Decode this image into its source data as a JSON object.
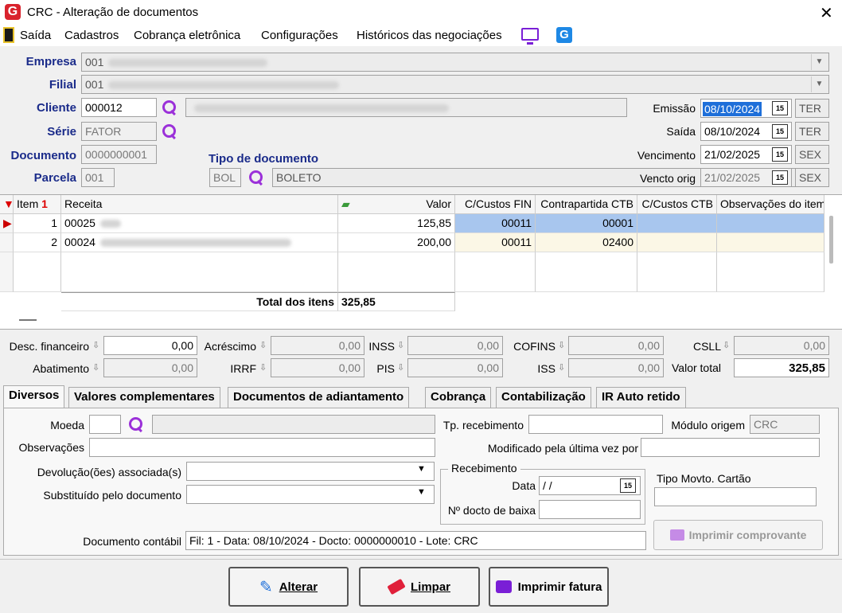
{
  "window": {
    "title": "CRC - Alteração de documentos",
    "logo": "G",
    "close": "✕"
  },
  "menu": [
    "Saída",
    "Cadastros",
    "Cobrança eletrônica",
    "Configurações",
    "Históricos das negociações"
  ],
  "header": {
    "empresa_label": "Empresa",
    "empresa_code": "001",
    "filial_label": "Filial",
    "filial_code": "001",
    "cliente_label": "Cliente",
    "cliente_value": "000012",
    "serie_label": "Série",
    "serie_value": "FATOR",
    "documento_label": "Documento",
    "documento_value": "0000000001",
    "parcela_label": "Parcela",
    "parcela_value": "001",
    "tipo_doc_label": "Tipo de documento",
    "tipo_doc_code": "BOL",
    "tipo_doc_name": "BOLETO",
    "emissao_label": "Emissão",
    "emissao_date": "08/10/2024",
    "emissao_day": "TER",
    "saida_label": "Saída",
    "saida_date": "08/10/2024",
    "saida_day": "TER",
    "vencimento_label": "Vencimento",
    "vencimento_date": "21/02/2025",
    "vencimento_day": "SEX",
    "vencto_orig_label": "Vencto orig",
    "vencto_orig_date": "21/02/2025",
    "vencto_orig_day": "SEX",
    "calendar_glyph": "15"
  },
  "grid": {
    "sort_glyph": "1",
    "columns": [
      "Item",
      "Receita",
      "Valor",
      "C/Custos FIN",
      "Contrapartida CTB",
      "C/Custos CTB",
      "Observações do item"
    ],
    "rows": [
      {
        "item": "1",
        "receita": "00025",
        "valor": "125,85",
        "cc_fin": "00011",
        "contrapartida": "00001",
        "cc_ctb": "",
        "obs": ""
      },
      {
        "item": "2",
        "receita": "00024",
        "valor": "200,00",
        "cc_fin": "00011",
        "contrapartida": "02400",
        "cc_ctb": "",
        "obs": ""
      }
    ],
    "total_label": "Total dos itens",
    "total_value": "325,85"
  },
  "totals": {
    "desc_fin_label": "Desc. financeiro",
    "desc_fin": "0,00",
    "acrescimo_label": "Acréscimo",
    "acrescimo": "0,00",
    "inss_label": "INSS",
    "inss": "0,00",
    "cofins_label": "COFINS",
    "cofins": "0,00",
    "csll_label": "CSLL",
    "csll": "0,00",
    "abatimento_label": "Abatimento",
    "abatimento": "0,00",
    "irrf_label": "IRRF",
    "irrf": "0,00",
    "pis_label": "PIS",
    "pis": "0,00",
    "iss_label": "ISS",
    "iss": "0,00",
    "valor_total_label": "Valor total",
    "valor_total": "325,85"
  },
  "tabs": [
    "Diversos",
    "Valores complementares",
    "Documentos de adiantamento",
    "Cobrança",
    "Contabilização",
    "IR Auto retido"
  ],
  "diversos": {
    "moeda_label": "Moeda",
    "observacoes_label": "Observações",
    "devolucoes_label": "Devolução(ões) associada(s)",
    "substituido_label": "Substituído pelo documento",
    "tp_receb_label": "Tp. recebimento",
    "modulo_label": "Módulo origem",
    "modulo_value": "CRC",
    "modificado_label": "Modificado pela última vez por",
    "recebimento_group": "Recebimento",
    "data_label": "Data",
    "data_value": " / /",
    "docto_baixa_label": "Nº docto de baixa",
    "tipo_movto_label": "Tipo Movto. Cartão",
    "imprimir_comp": "Imprimir comprovante",
    "doc_contabil_label": "Documento contábil",
    "doc_contabil_value": "Fil: 1 - Data: 08/10/2024 - Docto: 0000000010 - Lote: CRC"
  },
  "buttons": {
    "alterar": "Alterar",
    "limpar": "Limpar",
    "imprimir_fatura": "Imprimir fatura"
  }
}
